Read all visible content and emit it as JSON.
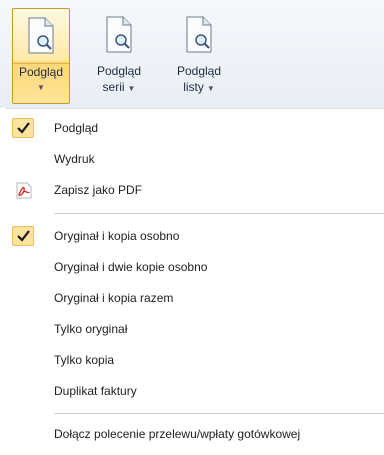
{
  "ribbon": {
    "buttons": [
      {
        "line1": "Podgląd",
        "line2": "",
        "icon": "document-magnifier-icon",
        "active": true
      },
      {
        "line1": "Podgląd",
        "line2": "serii",
        "icon": "document-magnifier-icon",
        "active": false
      },
      {
        "line1": "Podgląd",
        "line2": "listy",
        "icon": "document-magnifier-icon",
        "active": false
      }
    ]
  },
  "menu": {
    "items": [
      {
        "label": "Podgląd",
        "checked": true
      },
      {
        "label": "Wydruk",
        "checked": false
      },
      {
        "label": "Zapisz jako PDF",
        "icon": "pdf-icon"
      },
      {
        "label": "Oryginał i kopia osobno",
        "checked": true
      },
      {
        "label": "Oryginał i dwie kopie osobno",
        "checked": false
      },
      {
        "label": "Oryginał i kopia razem",
        "checked": false
      },
      {
        "label": "Tylko oryginał",
        "checked": false
      },
      {
        "label": "Tylko kopia",
        "checked": false
      },
      {
        "label": "Duplikat faktury",
        "checked": false
      },
      {
        "label": "Dołącz polecenie przelewu/wpłaty gotówkowej",
        "checked": false
      }
    ]
  },
  "colors": {
    "checkbox_fill": "#fde3a0",
    "active_button": "#ffd776",
    "pdf_red": "#d2231d"
  }
}
